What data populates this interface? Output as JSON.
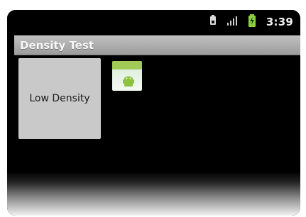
{
  "status_bar": {
    "time": "3:39",
    "icons": [
      "sim-icon",
      "signal-icon",
      "battery-charging-icon"
    ]
  },
  "app": {
    "title": "Density Test"
  },
  "content": {
    "density_label": "Low Density"
  },
  "colors": {
    "background": "#000000",
    "title_bar": "#a8a8a8",
    "panel": "#c9c9c9",
    "android_green": "#98c33f"
  }
}
